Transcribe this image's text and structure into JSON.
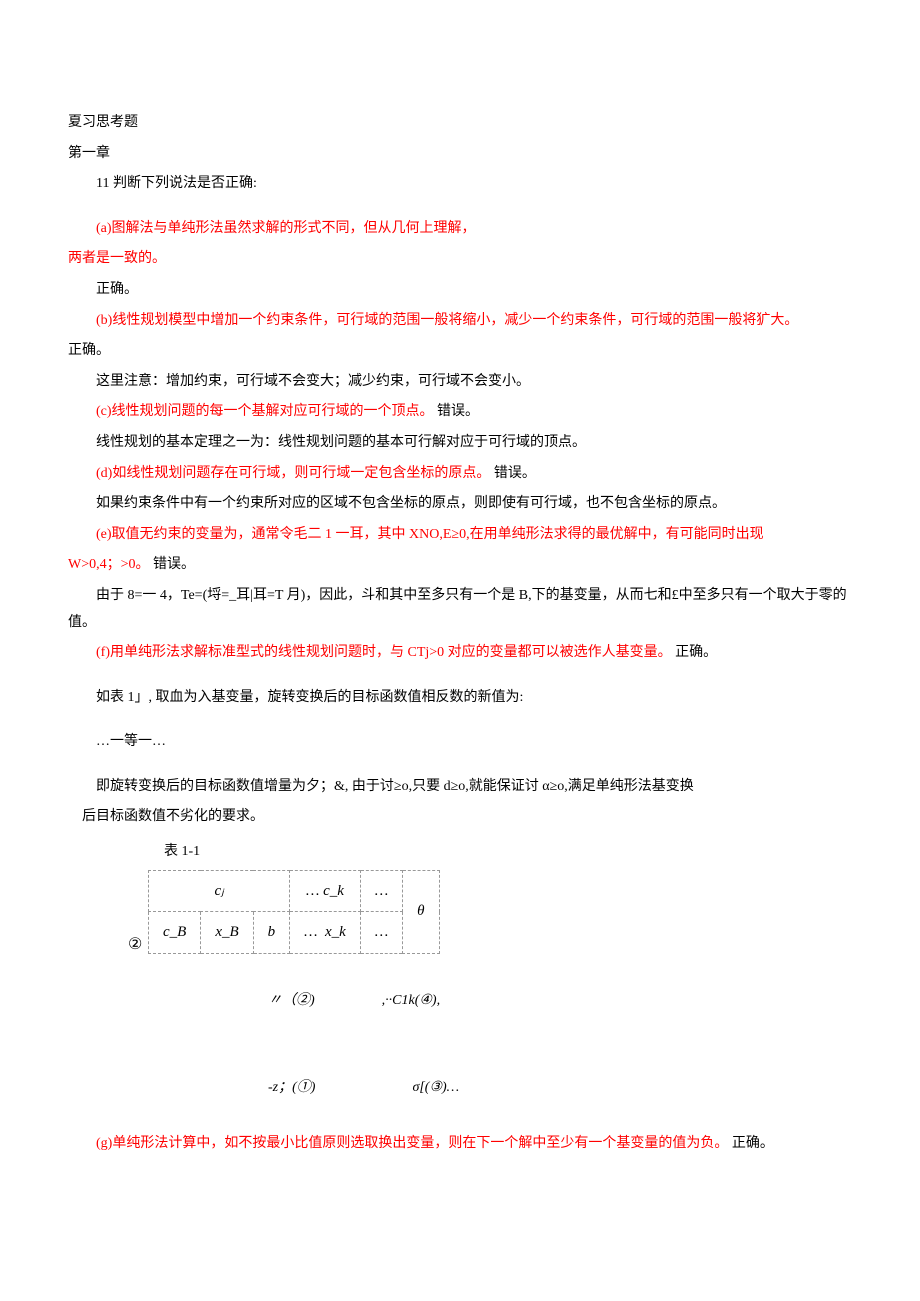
{
  "header": {
    "title": "夏习思考题",
    "chapter": "第一章",
    "q11": "11 判断下列说法是否正确:"
  },
  "a": {
    "text": "(a)图解法与单纯形法虽然求解的形式不同，但从几何上理解，",
    "cont": "两者是一致的。",
    "ans": "正确。"
  },
  "b": {
    "text": "(b)线性规划模型中增加一个约束条件，可行域的范围一般将缩小，减少一个约束条件，可行域的范围一般将犷大。",
    "ans": "正确。",
    "note": "这里注意：增加约束，可行域不会变大；减少约束，可行域不会变小。"
  },
  "c": {
    "text": "(c)线性规划问题的每一个基解对应可行域的一个顶点。",
    "ans": "错误。",
    "note": "线性规划的基本定理之一为：线性规划问题的基本可行解对应于可行域的顶点。"
  },
  "d": {
    "text": "(d)如线性规划问题存在可行域，则可行域一定包含坐标的原点。",
    "ans": "错误。",
    "note": "如果约束条件中有一个约束所对应的区域不包含坐标的原点，则即使有可行域，也不包含坐标的原点。"
  },
  "e": {
    "text1": "(e)取值无约束的变量为，通常令毛二 1 一耳，其中 XNO,E≥0,在用单纯形法求得的最优解中，有可能同时出现",
    "text2": "W>0,4；>0。",
    "ans": "错误。",
    "note": "由于 8=一 4，Te=(埒=_耳|耳=T 月)，因此，斗和其中至多只有一个是 B,下的基变量，从而七和£中至多只有一个取大于零的值。"
  },
  "f": {
    "text": "(f)用单纯形法求解标准型式的线性规划问题时，与 CTj>0 对应的变量都可以被选作人基变量。",
    "ans": "正确。",
    "note1": "如表 1」, 取血为入基变量，旋转变换后的目标函数值相反数的新值为:",
    "note2": "…一等一…",
    "note3": "即旋转变换后的目标函数值增量为夕；&, 由于讨≥o,只要 d≥o,就能保证讨 α≥o,满足单纯形法基变换",
    "note4": "后目标函数值不劣化的要求。"
  },
  "table": {
    "title": "表 1-1",
    "cj": "cⱼ",
    "ck": "c_k",
    "theta": "θ",
    "cB": "c_B",
    "xB": "x_B",
    "b": "b",
    "xk": "x_k",
    "dots": "…",
    "circ2": "②"
  },
  "mathlines": {
    "l1a": "〃（②)",
    "l1b": ",··C1k(④),",
    "l2a": "-z；(①)",
    "l2b": "σ[(③)…"
  },
  "g": {
    "text": "(g)单纯形法计算中，如不按最小比值原则选取换出变量，则在下一个解中至少有一个基变量的值为负。",
    "ans": "正确。"
  }
}
